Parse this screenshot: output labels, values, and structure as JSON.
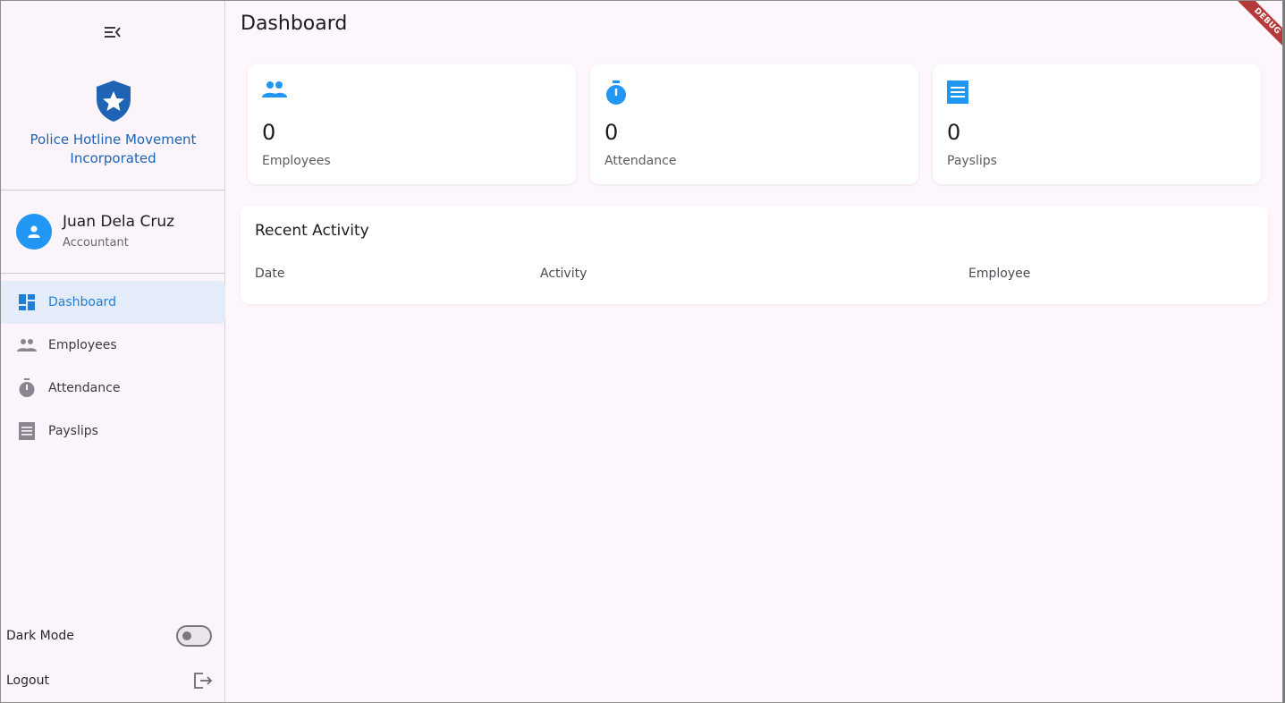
{
  "sidebar": {
    "brand": {
      "name_line1": "Police Hotline Movement",
      "name_line2": "Incorporated"
    },
    "user": {
      "name": "Juan Dela Cruz",
      "role": "Accountant"
    },
    "nav": [
      {
        "label": "Dashboard",
        "icon": "dashboard-icon",
        "active": true
      },
      {
        "label": "Employees",
        "icon": "people-icon",
        "active": false
      },
      {
        "label": "Attendance",
        "icon": "timer-icon",
        "active": false
      },
      {
        "label": "Payslips",
        "icon": "receipt-icon",
        "active": false
      }
    ],
    "dark_mode": {
      "label": "Dark Mode",
      "enabled": false
    },
    "logout": {
      "label": "Logout"
    }
  },
  "main": {
    "title": "Dashboard",
    "debug_banner": "DEBUG",
    "stats": [
      {
        "value": "0",
        "label": "Employees",
        "icon": "people-icon"
      },
      {
        "value": "0",
        "label": "Attendance",
        "icon": "timer-icon"
      },
      {
        "value": "0",
        "label": "Payslips",
        "icon": "receipt-icon"
      }
    ],
    "recent_activity": {
      "title": "Recent Activity",
      "columns": [
        "Date",
        "Activity",
        "Employee"
      ]
    }
  },
  "colors": {
    "accent": "#2196f3",
    "brand_blue": "#1f64b4",
    "background": "#fdf6fc",
    "active_nav_bg": "#e4ecfa",
    "debug_red": "#b53a3a"
  }
}
